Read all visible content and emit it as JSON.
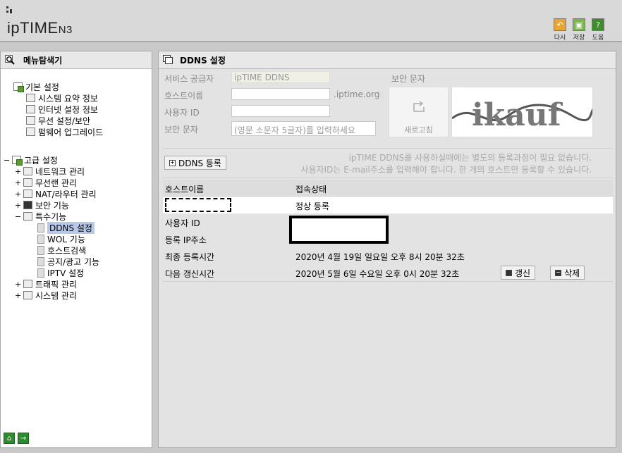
{
  "header": {
    "logo_main": "ipTIME",
    "logo_suffix": "N3",
    "buttons": [
      {
        "label": "다시"
      },
      {
        "label": "저장"
      },
      {
        "label": "도움"
      }
    ]
  },
  "sidebar": {
    "title": "메뉴탐색기",
    "basic": {
      "label": "기본 설정",
      "items": [
        "시스템 요약 정보",
        "인터넷 설정 정보",
        "무선 설정/보안",
        "펌웨어 업그레이드"
      ]
    },
    "advanced": {
      "toggle": "−",
      "label": "고급 설정",
      "groups": [
        {
          "toggle": "+",
          "label": "네트워크 관리"
        },
        {
          "toggle": "+",
          "label": "무선랜 관리"
        },
        {
          "toggle": "+",
          "label": "NAT/라우터 관리"
        },
        {
          "toggle": "+",
          "label": "보안 기능"
        },
        {
          "toggle": "−",
          "label": "특수기능"
        }
      ],
      "special_items": [
        "DDNS 설정",
        "WOL 기능",
        "호스트검색",
        "공지/광고 기능",
        "IPTV 설정"
      ],
      "tail_groups": [
        {
          "toggle": "+",
          "label": "트래픽 관리"
        },
        {
          "toggle": "+",
          "label": "시스템 관리"
        }
      ]
    }
  },
  "main": {
    "title": "DDNS 설정",
    "form": {
      "provider_label": "서비스 공급자",
      "provider_value": "ipTIME DDNS",
      "hostname_label": "호스트이름",
      "hostname_suffix": ".iptime.org",
      "userid_label": "사용자 ID",
      "security_label": "보안 문자",
      "security_placeholder": "(영문 소문자 5글자)를 입력하세요",
      "captcha_title": "보안 문자",
      "refresh_label": "새로고침",
      "captcha_text": "ikauf"
    },
    "register_button": "DDNS 등록",
    "info_line1": "ipTIME DDNS를 사용하실때에는 별도의 등록과정이 필요 없습니다.",
    "info_line2": "사용자ID는 E-mail주소를 입력해야 합니다. 한 개의 호스트만 등록할 수 있습니다.",
    "table": {
      "col_hostname": "호스트이름",
      "col_status": "접속상태",
      "row_status": "정상 등록"
    },
    "details": {
      "userid_label": "사용자 ID",
      "ip_label": "등록 IP주소",
      "last_reg_label": "최종 등록시간",
      "last_reg_value": "2020년 4월 19일 일요일 오후 8시 20분 32초",
      "next_renew_label": "다음 갱신시간",
      "next_renew_value": "2020년 5월 6일 수요일 오후 0시 20분 32초",
      "renew_button": "갱신",
      "delete_button": "삭제"
    }
  },
  "colors": {
    "toolbar_orange": "#e8a531",
    "toolbar_green": "#7ab648",
    "toolbar_darkgreen": "#3f8c2e",
    "selected_bg": "#b8c8e8"
  }
}
